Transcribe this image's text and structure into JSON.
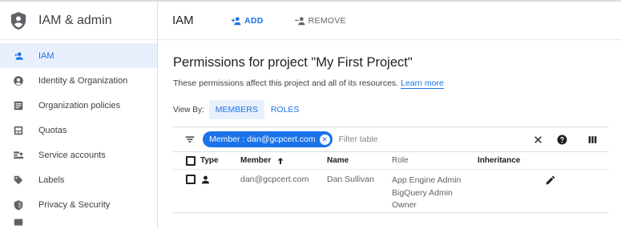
{
  "app": {
    "title": "IAM & admin"
  },
  "sidebar": {
    "items": [
      {
        "label": "IAM",
        "icon": "person-add-icon",
        "active": true
      },
      {
        "label": "Identity & Organization",
        "icon": "account-circle-icon",
        "active": false
      },
      {
        "label": "Organization policies",
        "icon": "list-doc-icon",
        "active": false
      },
      {
        "label": "Quotas",
        "icon": "quota-icon",
        "active": false
      },
      {
        "label": "Service accounts",
        "icon": "service-account-icon",
        "active": false
      },
      {
        "label": "Labels",
        "icon": "label-tag-icon",
        "active": false
      },
      {
        "label": "Privacy & Security",
        "icon": "shield-icon",
        "active": false
      }
    ]
  },
  "header": {
    "page_title": "IAM",
    "add_label": "ADD",
    "remove_label": "REMOVE"
  },
  "main": {
    "title": "Permissions for project \"My First Project\"",
    "subtitle": "These permissions affect this project and all of its resources.",
    "learn_more": "Learn more",
    "view_by_label": "View By:",
    "view_tabs": [
      {
        "label": "MEMBERS",
        "selected": true
      },
      {
        "label": "ROLES",
        "selected": false
      }
    ]
  },
  "filter": {
    "chip_label": "Member : dan@gcpcert.com",
    "placeholder": "Filter table"
  },
  "table": {
    "columns": {
      "type": "Type",
      "member": "Member",
      "name": "Name",
      "role": "Role",
      "inheritance": "Inheritance"
    },
    "rows": [
      {
        "member": "dan@gcpcert.com",
        "name": "Dan Sullivan",
        "roles": [
          "App Engine Admin",
          "BigQuery Admin",
          "Owner"
        ],
        "inheritance": ""
      }
    ]
  },
  "colors": {
    "accent": "#1a73e8",
    "active_bg": "#e8f0fe",
    "text": "#202124",
    "muted": "#5f6368",
    "divider": "#dadce0"
  }
}
